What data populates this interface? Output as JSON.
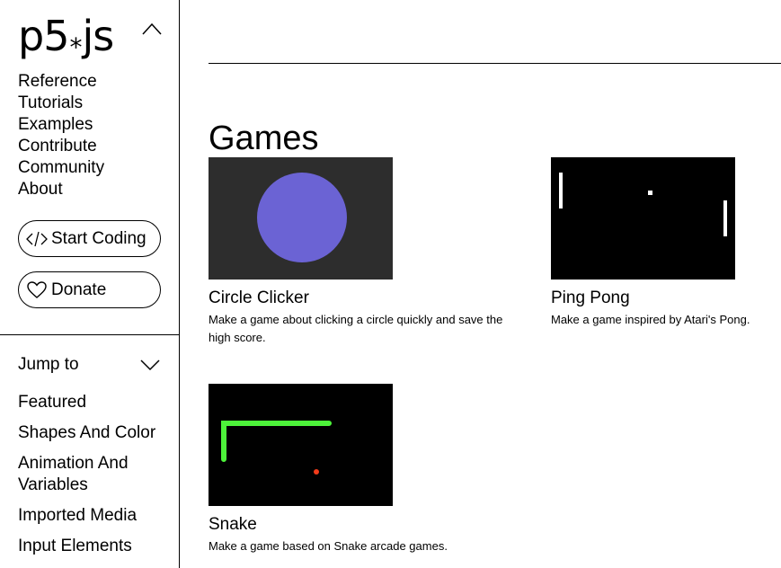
{
  "logo": {
    "text_main": "p5",
    "text_star": "*",
    "text_end": "js"
  },
  "nav": {
    "items": [
      {
        "label": "Reference"
      },
      {
        "label": "Tutorials"
      },
      {
        "label": "Examples"
      },
      {
        "label": "Contribute"
      },
      {
        "label": "Community"
      },
      {
        "label": "About"
      }
    ]
  },
  "buttons": {
    "start_coding": "Start Coding",
    "donate": "Donate"
  },
  "jump": {
    "label": "Jump to",
    "items": [
      {
        "label": "Featured"
      },
      {
        "label": "Shapes And Color"
      },
      {
        "label": "Animation And Variables"
      },
      {
        "label": "Imported Media"
      },
      {
        "label": "Input Elements"
      }
    ]
  },
  "main": {
    "title": "Games",
    "cards": [
      {
        "title": "Circle Clicker",
        "description": "Make a game about clicking a circle quickly and save the high score."
      },
      {
        "title": "Ping Pong",
        "description": "Make a game inspired by Atari's Pong."
      },
      {
        "title": "Snake",
        "description": "Make a game based on Snake arcade games."
      }
    ]
  },
  "colors": {
    "circle_bg": "#2d2d2d",
    "circle_fill": "#6b63d4",
    "snake_green": "#4df33a",
    "snake_food": "#f23b1a"
  }
}
